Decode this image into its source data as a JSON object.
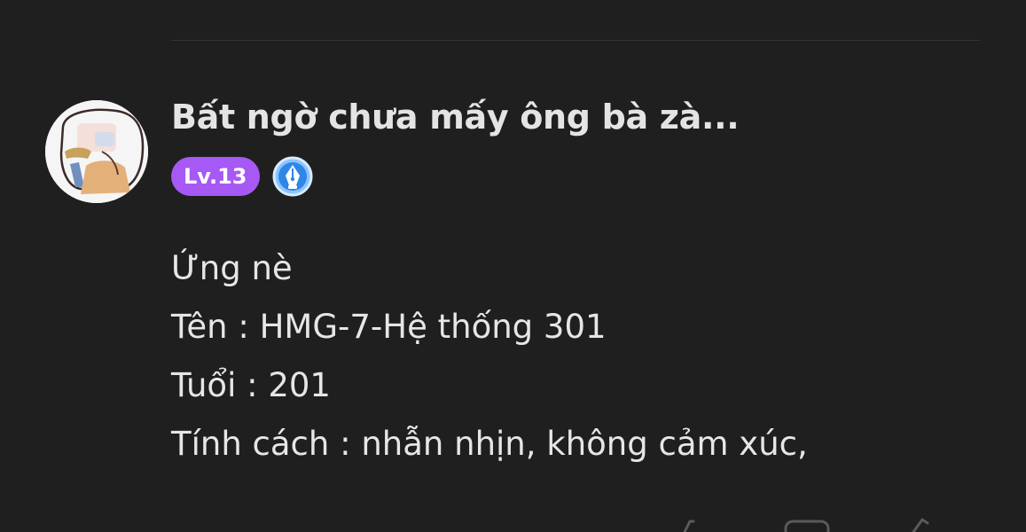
{
  "post": {
    "author": {
      "name": "Bất ngờ chưa mấy ông bà zà...",
      "level": "Lv.13",
      "avatar_icon": "avatar-drawing-icon",
      "creator_badge_icon": "pen-nib-badge-icon"
    },
    "body_lines": [
      "Ứng nè",
      "Tên : HMG-7-Hệ thống 301",
      "Tuổi : 201",
      "Tính cách : nhẫn nhịn, không cảm xúc,"
    ]
  },
  "colors": {
    "background": "#1f1f1f",
    "text": "#e6e6e6",
    "level_badge": "#a659f4",
    "creator_badge": "#2f86e6"
  },
  "action_bar": {
    "icons": [
      "like-icon",
      "comment-icon",
      "share-icon"
    ]
  }
}
